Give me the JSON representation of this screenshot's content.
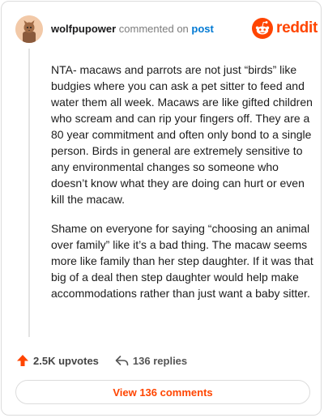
{
  "header": {
    "username": "wolfpupower",
    "action_text": "commented on",
    "post_link": "post",
    "brand": "reddit"
  },
  "comment": {
    "paragraphs": [
      "NTA- macaws and parrots are not just “birds” like budgies where you can ask a pet sitter to feed and water them all week. Macaws are like gifted children who scream and can rip your fingers off. They are a 80 year commitment and often only bond to a single person. Birds in general are extremely sensitive to any environmental changes so someone who doesn’t know what they are doing can hurt or even kill the macaw.",
      "Shame on everyone for saying “choosing an animal over family” like it’s a bad thing. The macaw seems more like family than her step daughter. If it was that big of a deal then step daughter would help make accommodations rather than just want a baby sitter."
    ]
  },
  "actions": {
    "upvotes": "2.5K upvotes",
    "replies": "136 replies"
  },
  "view_button": "View 136 comments",
  "icons": {
    "avatar": "avatar-icon",
    "brand": "reddit-logo-icon",
    "upvote": "upvote-arrow-icon",
    "reply": "reply-arrow-icon"
  },
  "colors": {
    "brand": "#ff4500",
    "link": "#0079d3"
  }
}
